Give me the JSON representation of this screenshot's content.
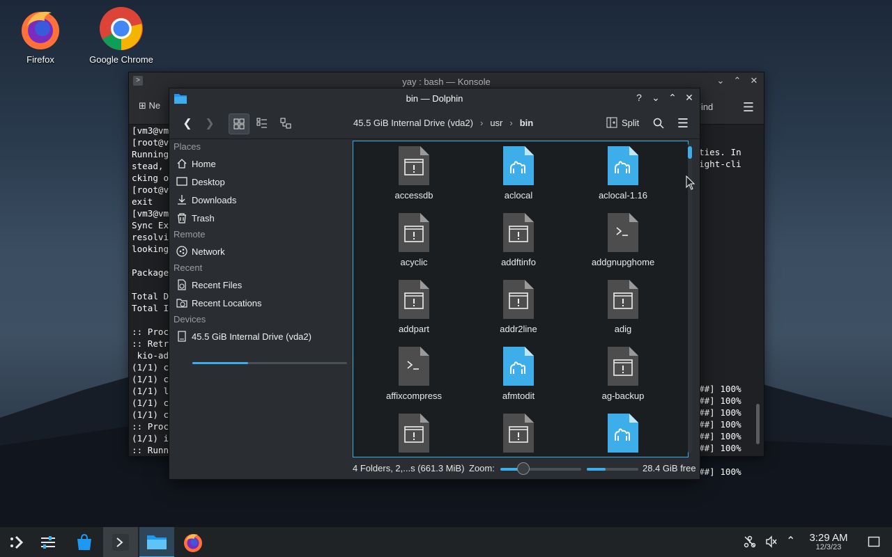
{
  "desktop": {
    "icons": [
      {
        "label": "Firefox"
      },
      {
        "label": "Google Chrome"
      }
    ]
  },
  "konsole": {
    "title": "yay : bash — Konsole",
    "new_tab_label": "Ne",
    "find_label": "Find",
    "terminal_left_lines": "[vm3@vm\n[root@v\nRunning\nstead, \ncking o\n[root@v\nexit\n[vm3@vm\nSync Ex\nresolvi\nlooking\n\nPackage\n\nTotal D\nTotal I\n\n:: Proc\n:: Retr\n kio-ad\n(1/1) c\n(1/1) c\n(1/1) l\n(1/1) c\n(1/1) c\n:: Proc\n(1/1) i\n:: Runn",
    "terminal_right_lines": "ties. In\night-cli\n\n\n\n\n\n\n\n\n\n\n\n\n\n\n\n\n\n\n##] 100%\n##] 100%\n##] 100%\n##] 100%\n##] 100%\n##] 100%\n\n##] 100%"
  },
  "dolphin": {
    "title": "bin — Dolphin",
    "breadcrumbs": [
      "45.5 GiB Internal Drive (vda2)",
      "usr",
      "bin"
    ],
    "split_label": "Split",
    "places": {
      "sections": [
        {
          "heading": "Places",
          "items": [
            "Home",
            "Desktop",
            "Downloads",
            "Trash"
          ]
        },
        {
          "heading": "Remote",
          "items": [
            "Network"
          ]
        },
        {
          "heading": "Recent",
          "items": [
            "Recent Files",
            "Recent Locations"
          ]
        },
        {
          "heading": "Devices",
          "items": [
            "45.5 GiB Internal Drive (vda2)"
          ]
        }
      ],
      "drive_usage": 0.36
    },
    "files": [
      {
        "name": "accessdb",
        "type": "exec"
      },
      {
        "name": "aclocal",
        "type": "perl"
      },
      {
        "name": "aclocal-1.16",
        "type": "perl"
      },
      {
        "name": "acyclic",
        "type": "exec"
      },
      {
        "name": "addftinfo",
        "type": "exec"
      },
      {
        "name": "addgnupghome",
        "type": "script"
      },
      {
        "name": "addpart",
        "type": "exec"
      },
      {
        "name": "addr2line",
        "type": "exec"
      },
      {
        "name": "adig",
        "type": "exec"
      },
      {
        "name": "affixcompress",
        "type": "script"
      },
      {
        "name": "afmtodit",
        "type": "perl"
      },
      {
        "name": "ag-backup",
        "type": "exec"
      },
      {
        "name": "",
        "type": "exec"
      },
      {
        "name": "",
        "type": "exec"
      },
      {
        "name": "",
        "type": "perl"
      }
    ],
    "status": {
      "info": "4 Folders, 2,...s (661.3 MiB)",
      "zoom_label": "Zoom:",
      "free_label": "28.4 GiB free",
      "free_usage": 0.36
    }
  },
  "taskbar": {
    "time": "3:29 AM",
    "date": "12/3/23"
  },
  "colors": {
    "accent": "#3daee9",
    "window_bg": "#2a2e32",
    "view_bg": "#1b1e20",
    "taskbar_bg": "#202326"
  }
}
